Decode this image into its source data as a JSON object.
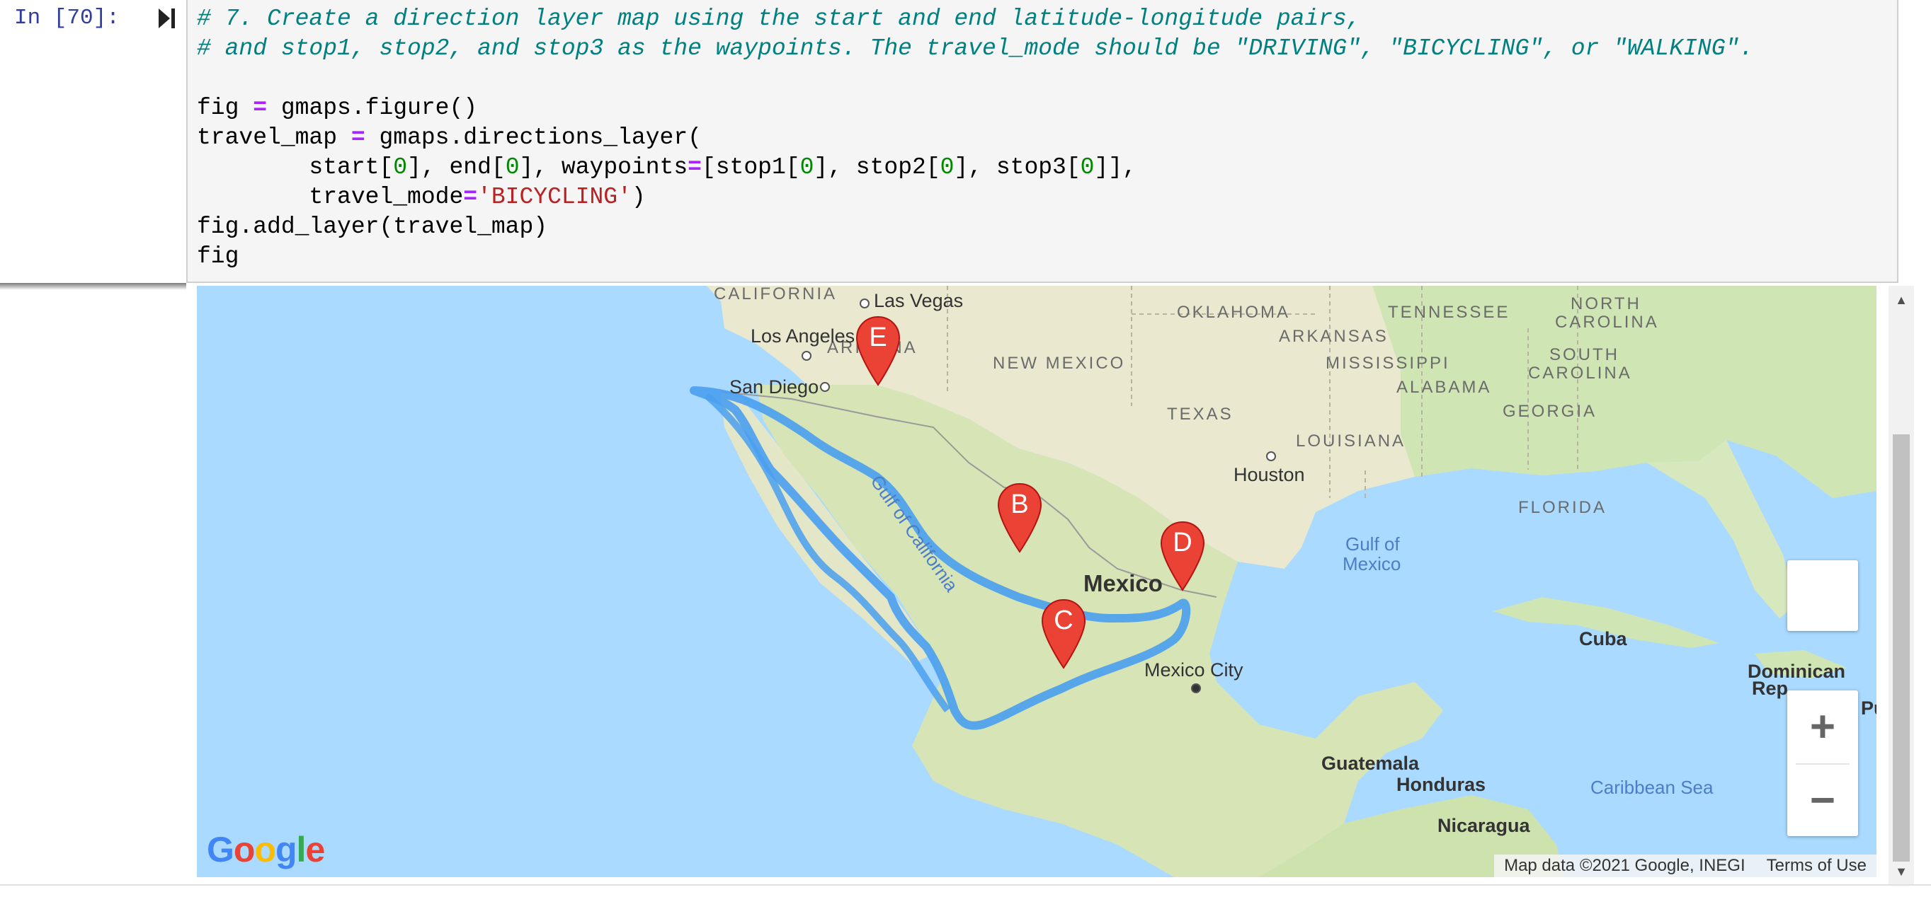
{
  "cell": {
    "prompt": "In [70]:",
    "run_icon": "run-cell-icon",
    "lines": {
      "l1": "# 7. Create a direction layer map using the start and end latitude-longitude pairs,",
      "l2": "# and stop1, stop2, and stop3 as the waypoints. The travel_mode should be \"DRIVING\", \"BICYCLING\", or \"WALKING\".",
      "l4a": "fig ",
      "l4op": "=",
      "l4b": " gmaps.figure()",
      "l5a": "travel_map ",
      "l5op": "=",
      "l5b": " gmaps.directions_layer(",
      "l6a": "        start[",
      "l6n1": "0",
      "l6b": "], end[",
      "l6n2": "0",
      "l6c": "], waypoints",
      "l6op": "=",
      "l6d": "[stop1[",
      "l6n3": "0",
      "l6e": "], stop2[",
      "l6n4": "0",
      "l6f": "], stop3[",
      "l6n5": "0",
      "l6g": "]],",
      "l7a": "        travel_mode",
      "l7op": "=",
      "l7s": "'BICYCLING'",
      "l7b": ")",
      "l8": "fig.add_layer(travel_map)",
      "l9": "fig"
    }
  },
  "map": {
    "route_color": "#4a9ff0",
    "marker_color": "#ea4335",
    "markers": {
      "e": "E",
      "b": "B",
      "c": "C",
      "d": "D"
    },
    "states": {
      "california": "CALIFORNIA",
      "arizona": "ARIZONA",
      "new_mexico": "NEW MEXICO",
      "oklahoma": "OKLAHOMA",
      "texas": "TEXAS",
      "arkansas": "ARKANSAS",
      "tennessee": "TENNESSEE",
      "mississippi": "MISSISSIPPI",
      "alabama": "ALABAMA",
      "georgia": "GEORGIA",
      "louisiana": "LOUISIANA",
      "florida": "FLORIDA",
      "north_carolina_1": "NORTH",
      "north_carolina_2": "CAROLINA",
      "south_carolina_1": "SOUTH",
      "south_carolina_2": "CAROLINA"
    },
    "cities": {
      "las_vegas": "Las Vegas",
      "los_angeles": "Los Angeles",
      "san_diego": "San Diego",
      "houston": "Houston",
      "mexico_city": "Mexico City",
      "guatemala": "Guatemala",
      "honduras": "Honduras",
      "nicaragua": "Nicaragua",
      "cuba": "Cuba",
      "dominican_1": "Dominican",
      "dominican_2": "Rep",
      "pu": "Pu"
    },
    "countries": {
      "mexico": "Mexico"
    },
    "water": {
      "gulf_of_mexico_1": "Gulf of",
      "gulf_of_mexico_2": "Mexico",
      "gulf_of_california": "Gulf of California",
      "caribbean_sea": "Caribbean Sea"
    },
    "controls": {
      "zoom_in": "+",
      "zoom_out": "−"
    },
    "attribution": {
      "map_data": "Map data ©2021 Google, INEGI",
      "terms": "Terms of Use"
    },
    "logo": {
      "g": "G",
      "o1": "o",
      "o2": "o",
      "g2": "g",
      "l": "l",
      "e": "e"
    }
  }
}
